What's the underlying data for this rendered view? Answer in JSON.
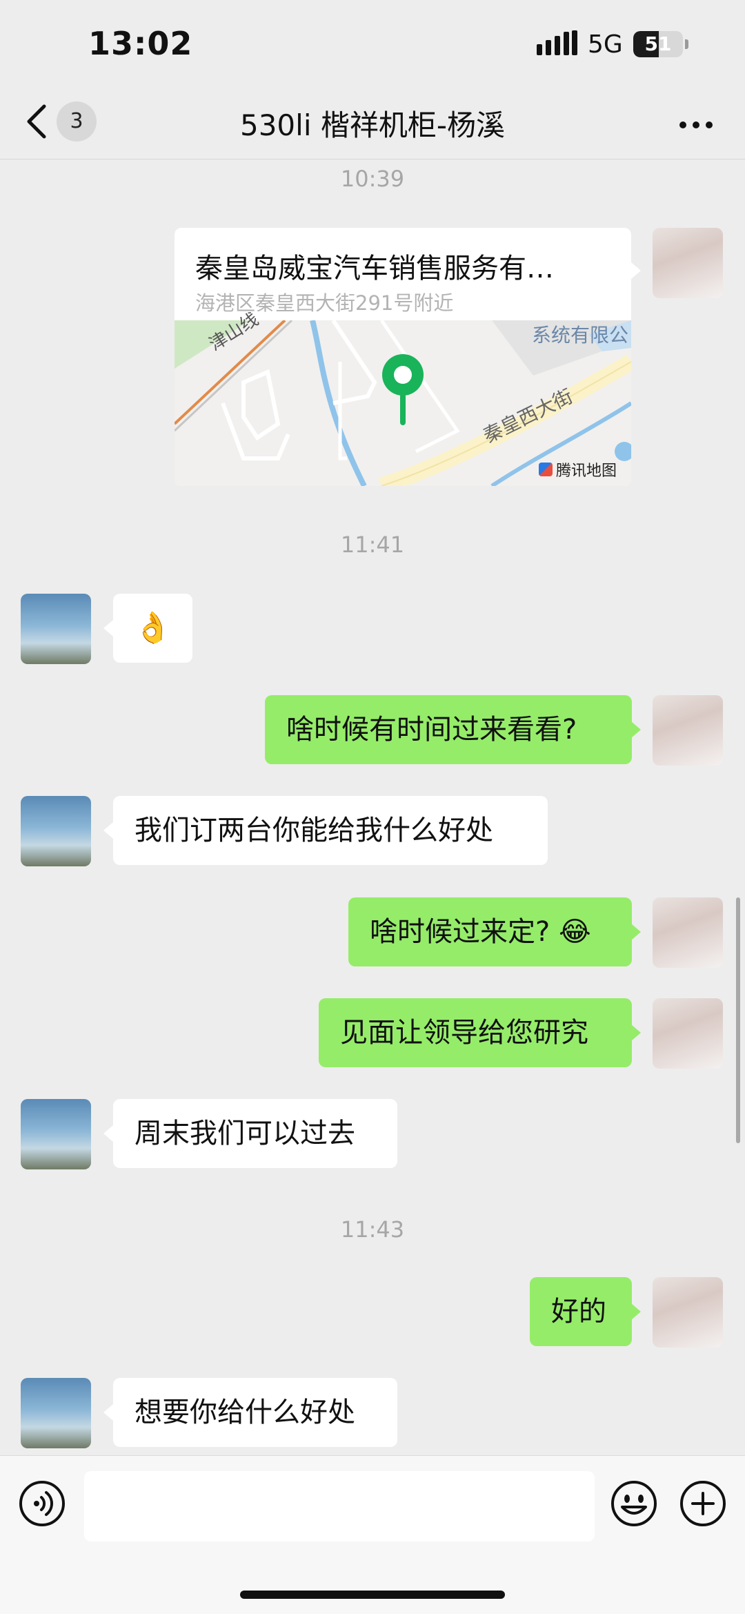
{
  "status_bar": {
    "time": "13:02",
    "network": "5G",
    "battery": "51"
  },
  "nav": {
    "back_badge": "3",
    "title": "530li 楷祥机柜-杨溪"
  },
  "messages": {
    "ts1": "10:39",
    "location": {
      "title": "秦皇岛威宝汽车销售服务有…",
      "address": "海港区秦皇西大街291号附近",
      "map_label_road1": "津山线",
      "map_label_road2": "秦皇西大街",
      "map_label_company": "系统有限公",
      "map_provider": "腾讯地图"
    },
    "ts2": "11:41",
    "m1_emoji": "👌",
    "m2": "啥时候有时间过来看看?",
    "m3": "我们订两台你能给我什么好处",
    "m4": "啥时候过来定?",
    "m4_emoji": "😂",
    "m5": "见面让领导给您研究",
    "m6": "周末我们可以过去",
    "ts3": "11:43",
    "m7": "好的",
    "m8": "想要你给什么好处"
  },
  "colors": {
    "me_bubble": "#95ec69",
    "other_bubble": "#ffffff",
    "background": "#ededed",
    "map_pin": "#19b35a"
  },
  "icons": {
    "back": "chevron-left-icon",
    "more": "more-icon",
    "voice": "voice-icon",
    "emoji": "emoji-icon",
    "add": "plus-icon"
  }
}
